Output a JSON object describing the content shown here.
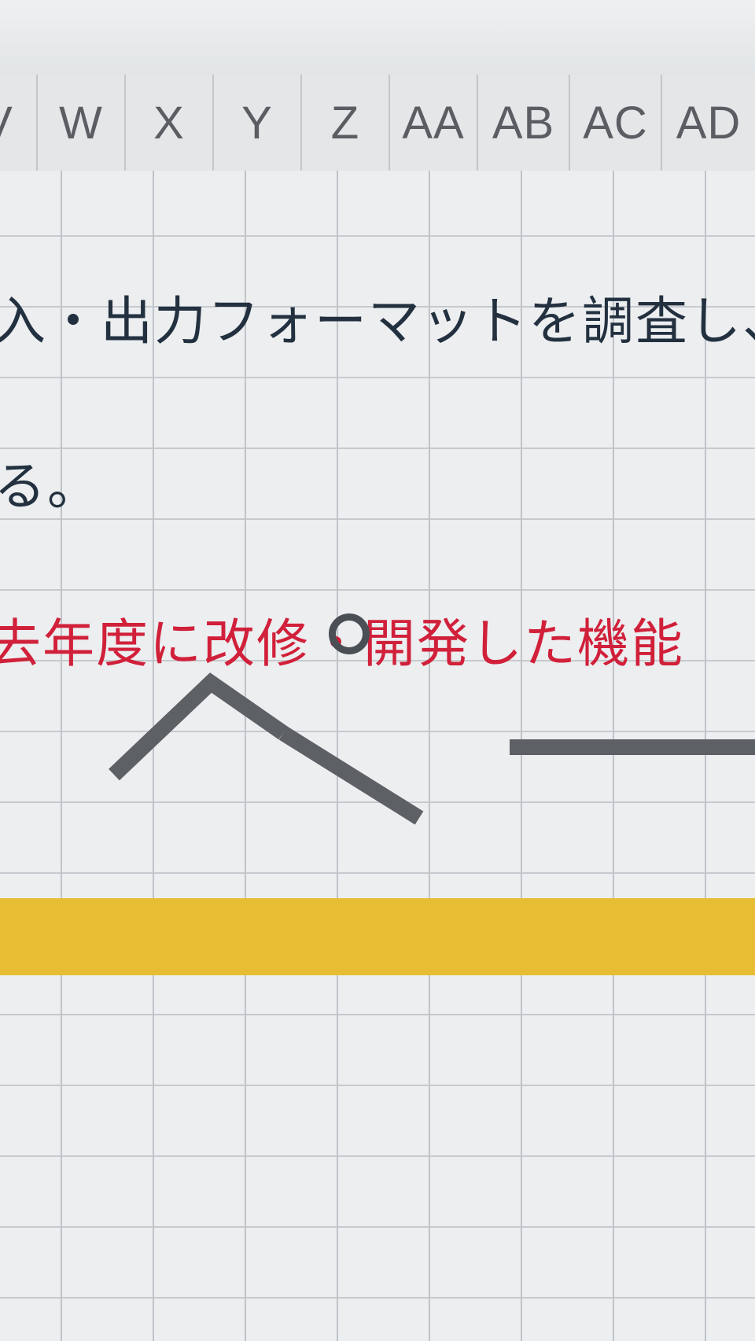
{
  "window": {
    "title": ""
  },
  "column_headers": [
    "V",
    "W",
    "X",
    "Y",
    "Z",
    "AA",
    "AB",
    "AC",
    "AD"
  ],
  "cells": {
    "line1": "入・出力フォーマットを調査し、",
    "line2": "る。",
    "line3": "去年度に改修・開発した機能"
  },
  "shape": {
    "name": "caret-line-shape",
    "selected": true
  },
  "colors": {
    "black_text": "#22303f",
    "red_text": "#d1203a",
    "highlight_row": "#e6bd33",
    "shape_stroke": "#5d6166"
  }
}
